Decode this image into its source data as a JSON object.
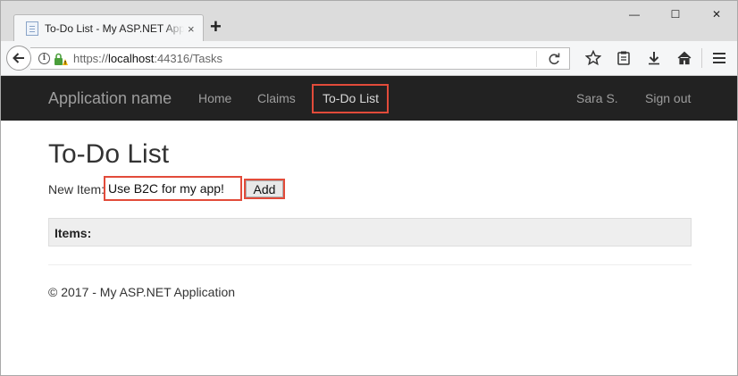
{
  "browser": {
    "tab_title": "To-Do List - My ASP.NET Application",
    "tab_close": "×",
    "new_tab": "+",
    "url_scheme": "https://",
    "url_host": "localhost",
    "url_rest": ":44316/Tasks"
  },
  "window_controls": {
    "minimize": "—",
    "maximize": "☐",
    "close": "✕"
  },
  "site_nav": {
    "brand": "Application name",
    "links": [
      "Home",
      "Claims",
      "To-Do List"
    ],
    "user": "Sara S.",
    "sign_out": "Sign out"
  },
  "main": {
    "title": "To-Do List",
    "new_item_label": "New Item:",
    "new_item_value": "Use B2C for my app!",
    "add_label": "Add",
    "items_header": "Items:",
    "footer": "© 2017 - My ASP.NET Application"
  },
  "colors": {
    "highlight": "#e24b3a",
    "navbar_bg": "#222222",
    "nav_text": "#9d9d9d"
  }
}
